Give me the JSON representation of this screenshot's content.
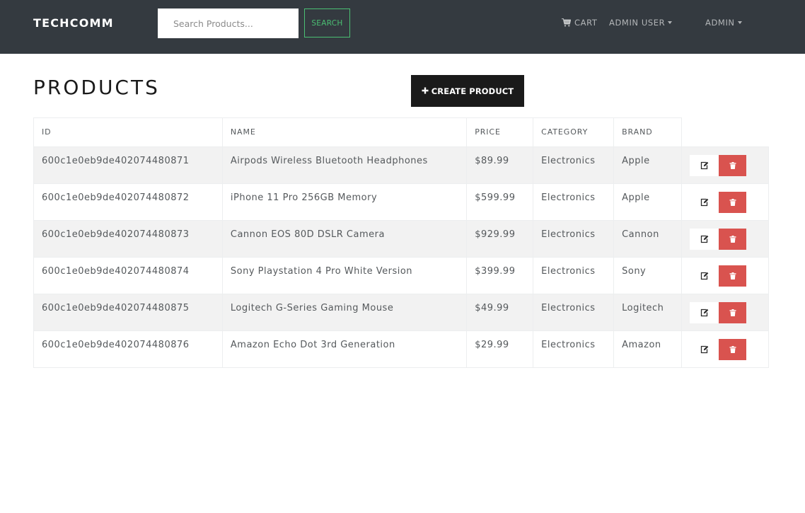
{
  "navbar": {
    "brand": "TECHCOMM",
    "search_placeholder": "Search Products...",
    "search_label": "SEARCH",
    "cart_label": "CART",
    "user_label": "ADMIN USER",
    "admin_label": "ADMIN"
  },
  "main": {
    "title": "PRODUCTS",
    "create_label": "CREATE PRODUCT"
  },
  "table": {
    "headers": [
      "ID",
      "NAME",
      "PRICE",
      "CATEGORY",
      "BRAND"
    ],
    "rows": [
      {
        "id": "600c1e0eb9de402074480871",
        "name": "Airpods Wireless Bluetooth Headphones",
        "price": "$89.99",
        "category": "Electronics",
        "brand": "Apple"
      },
      {
        "id": "600c1e0eb9de402074480872",
        "name": "iPhone 11 Pro 256GB Memory",
        "price": "$599.99",
        "category": "Electronics",
        "brand": "Apple"
      },
      {
        "id": "600c1e0eb9de402074480873",
        "name": "Cannon EOS 80D DSLR Camera",
        "price": "$929.99",
        "category": "Electronics",
        "brand": "Cannon"
      },
      {
        "id": "600c1e0eb9de402074480874",
        "name": "Sony Playstation 4 Pro White Version",
        "price": "$399.99",
        "category": "Electronics",
        "brand": "Sony"
      },
      {
        "id": "600c1e0eb9de402074480875",
        "name": "Logitech G-Series Gaming Mouse",
        "price": "$49.99",
        "category": "Electronics",
        "brand": "Logitech"
      },
      {
        "id": "600c1e0eb9de402074480876",
        "name": "Amazon Echo Dot 3rd Generation",
        "price": "$29.99",
        "category": "Electronics",
        "brand": "Amazon"
      }
    ]
  },
  "icons": {
    "cart": "shopping-cart-icon",
    "create": "plus-icon",
    "edit": "edit-icon",
    "delete": "trash-icon"
  },
  "colors": {
    "navbar_bg": "#343a40",
    "search_accent": "#4bbf73",
    "delete_button": "#d9534f",
    "create_button_bg": "#1a1a1a",
    "row_stripe": "#f2f2f2"
  }
}
